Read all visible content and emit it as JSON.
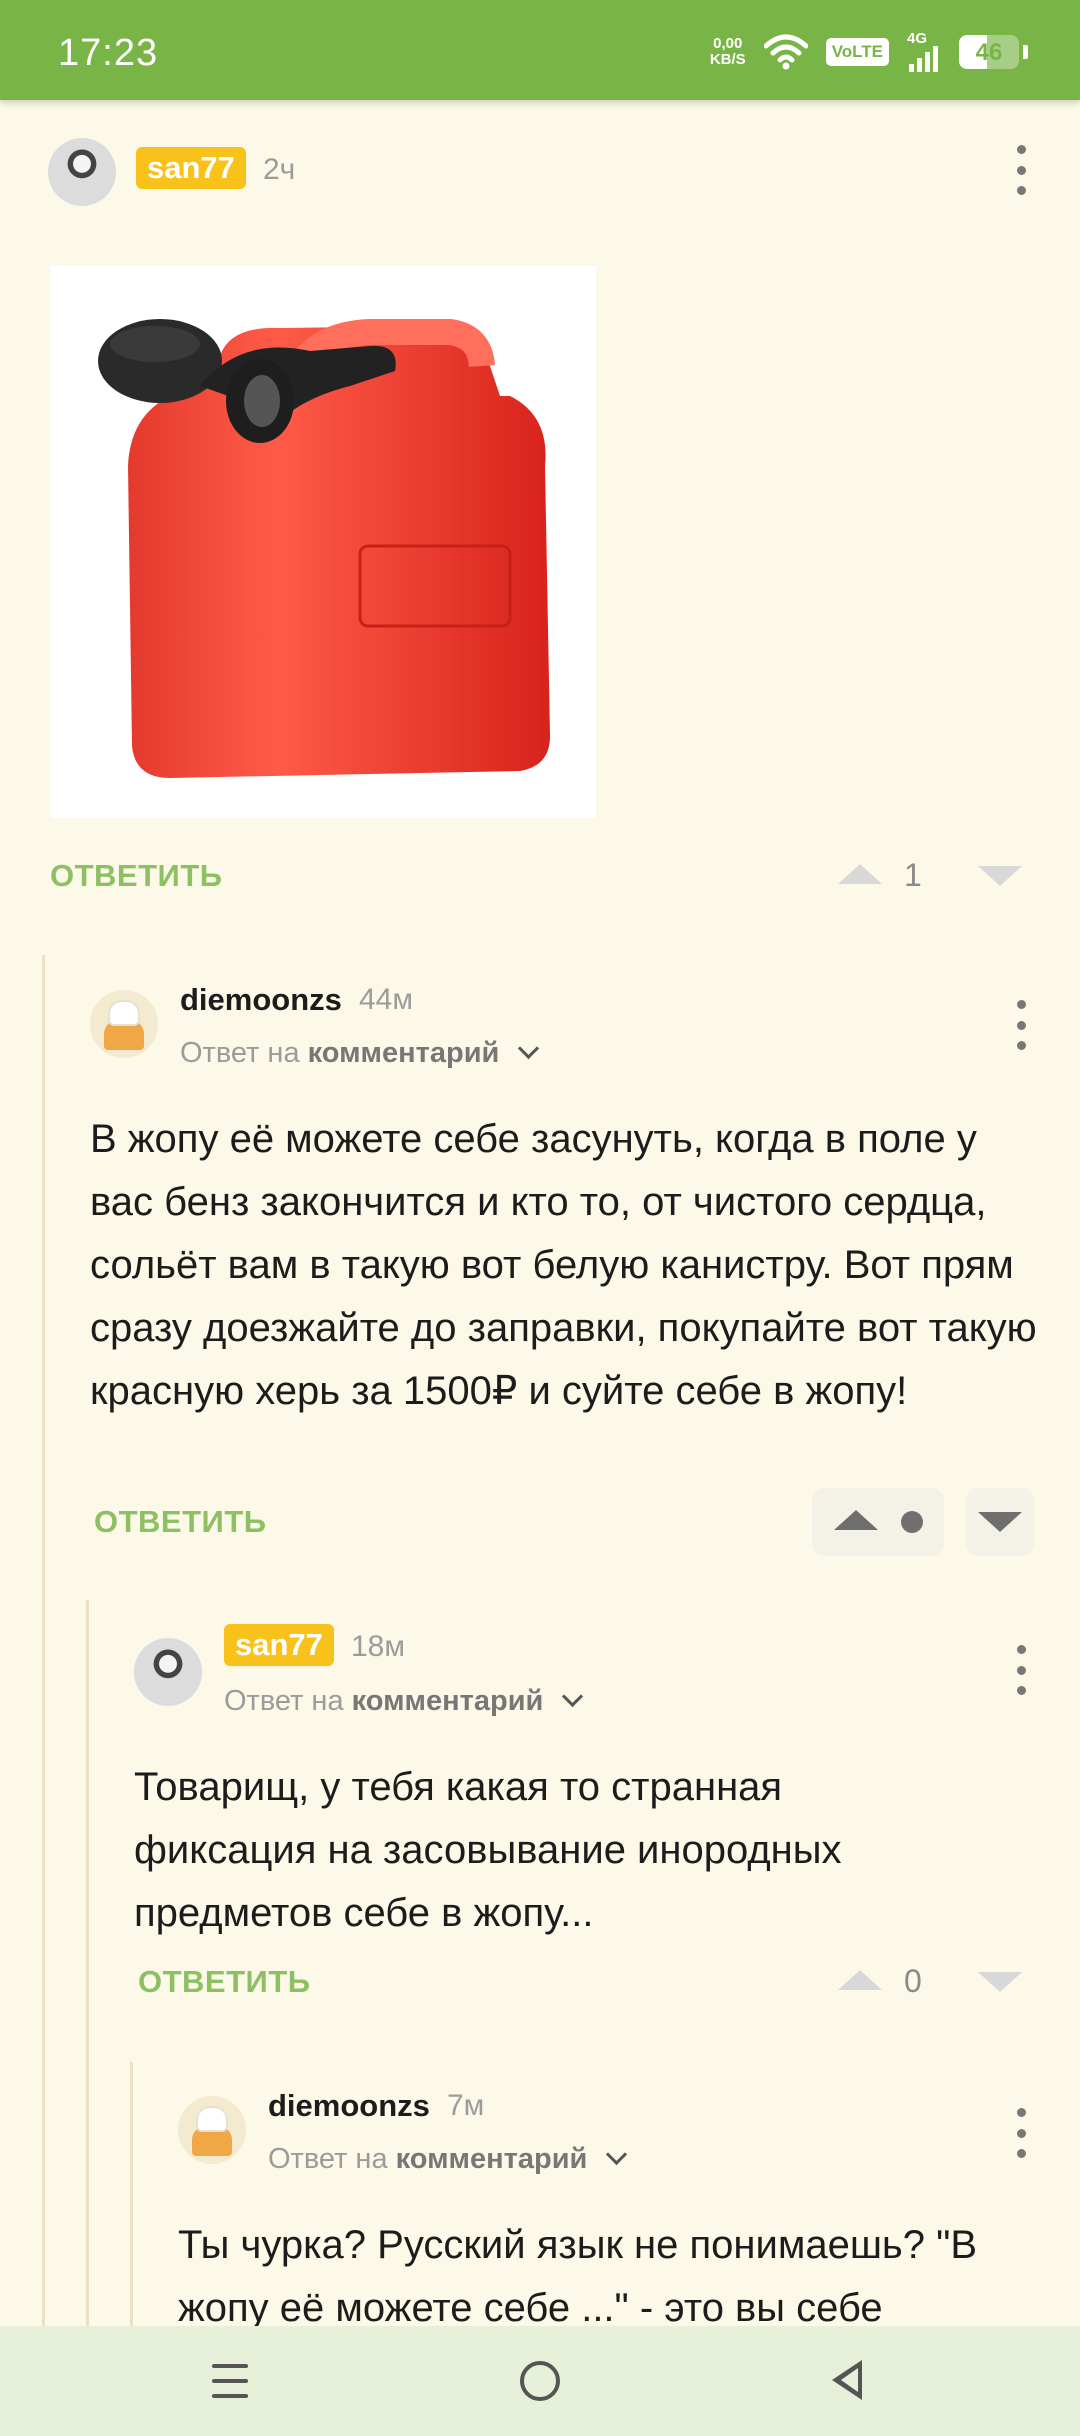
{
  "status_bar": {
    "time": "17:23",
    "net_speed_value": "0,00",
    "net_speed_unit": "KB/S",
    "volte": "VoLTE",
    "signal": "4G",
    "battery": "46"
  },
  "comments": [
    {
      "author": "san77",
      "time": "2ч",
      "image_alt": "red fuel canister",
      "reply_label": "ОТВЕТИТЬ",
      "score": "1"
    },
    {
      "author": "diemoonzs",
      "time": "44м",
      "reply_prefix": "Ответ на",
      "reply_target": "комментарий",
      "text": "В жопу её можете себе засунуть, когда в поле у вас бенз закончится и кто то, от чистого сердца, сольёт вам в такую вот белую канистру. Вот прям сразу доезжайте до заправки, покупайте вот такую красную херь за 1500₽ и суйте себе в жопу!",
      "reply_label": "ОТВЕТИТЬ"
    },
    {
      "author": "san77",
      "time": "18м",
      "reply_prefix": "Ответ на",
      "reply_target": "комментарий",
      "text": "Товарищ, у тебя какая то странная фиксация на засовывание инородных предметов себе в жопу...",
      "reply_label": "ОТВЕТИТЬ",
      "score": "0"
    },
    {
      "author": "diemoonzs",
      "time": "7м",
      "reply_prefix": "Ответ на",
      "reply_target": "комментарий",
      "text": "Ты чурка? Русский язык не понимаешь? \"В жопу её можете себе ...\" - это вы себе"
    }
  ],
  "colors": {
    "status_bar": "#79b447",
    "background": "#fdf9e8",
    "reply_link": "#8dc063",
    "username_badge": "#f8c21b"
  }
}
